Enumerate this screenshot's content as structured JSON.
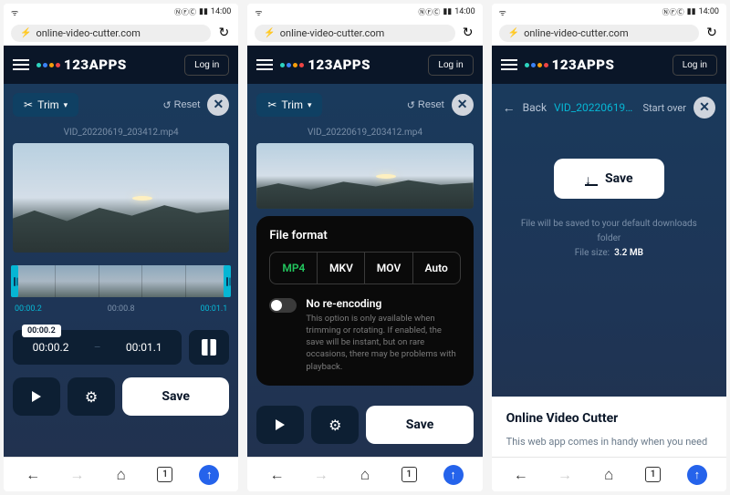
{
  "status": {
    "time": "14:00"
  },
  "urlbar": {
    "url": "online-video-cutter.com"
  },
  "header": {
    "brand": "123APPS",
    "login": "Log in"
  },
  "toolbar": {
    "trim_label": "Trim",
    "reset_label": "Reset"
  },
  "file": {
    "name": "VID_20220619_203412.mp4",
    "short_name": "VID_20220619_203412"
  },
  "timeline": {
    "badge": "00:00.2",
    "labels": [
      "00:00.2",
      "00:00.8",
      "00:01.1"
    ]
  },
  "time_panel": {
    "start": "00:00.2",
    "end": "00:01.1"
  },
  "actions": {
    "save": "Save"
  },
  "format": {
    "title": "File format",
    "options": [
      "MP4",
      "MKV",
      "MOV",
      "Auto"
    ],
    "selected": "MP4",
    "toggle_label": "No re-encoding",
    "toggle_desc": "This option is only available when trimming or rotating. If enabled, the save will be instant, but on rare occasions, there may be problems with playback."
  },
  "save_screen": {
    "back": "Back",
    "start_over": "Start over",
    "save": "Save",
    "info_line": "File will be saved to your default downloads folder",
    "size_label": "File size:",
    "size_value": "3.2 MB"
  },
  "article": {
    "title": "Online Video Cutter",
    "body": "This web app comes in handy when you need"
  },
  "nav": {
    "tabs": "1"
  },
  "colors": {
    "accent_cyan": "#06b6d4",
    "accent_blue": "#2563eb",
    "bg_dark": "#1a3a5c",
    "format_active": "#22c55e"
  }
}
